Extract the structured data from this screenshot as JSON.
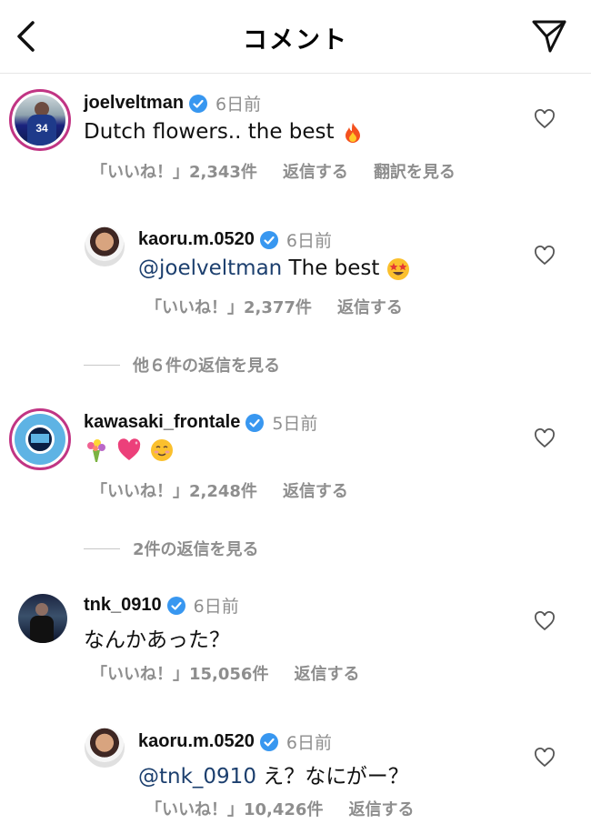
{
  "header": {
    "title": "コメント",
    "back_icon": "chevron-left-icon",
    "send_icon": "paper-plane-icon"
  },
  "comments": [
    {
      "username": "joelveltman",
      "time": "6日前",
      "text": "Dutch flowers.. the best",
      "emoji": "fire-emoji",
      "likes": "「いいね！」2,343件",
      "reply": "返信する",
      "translate": "翻訳を見る"
    },
    {
      "username": "kaoru.m.0520",
      "time": "6日前",
      "mention": "@joelveltman",
      "text": " The best",
      "emoji": "star-struck-emoji",
      "likes": "「いいね！」2,377件",
      "reply": "返信する"
    },
    {
      "more": "他６件の返信を見る"
    },
    {
      "username": "kawasaki_frontale",
      "time": "5日前",
      "emojis": [
        "bouquet-emoji",
        "heart-emoji",
        "smiling-emoji"
      ],
      "likes": "「いいね！」2,248件",
      "reply": "返信する"
    },
    {
      "more": "2件の返信を見る"
    },
    {
      "username": "tnk_0910",
      "time": "6日前",
      "text": "なんかあった？",
      "likes": "「いいね！」15,056件",
      "reply": "返信する"
    },
    {
      "username": "kaoru.m.0520",
      "time": "6日前",
      "mention": "@tnk_0910",
      "text": " え？なにがー？",
      "likes": "「いいね！」10,426件",
      "reply": "返信する"
    }
  ],
  "colors": {
    "accent": "#3897f0",
    "muted": "#8e8e8e",
    "mention": "#1c3f6e",
    "ring": "#c13584"
  }
}
